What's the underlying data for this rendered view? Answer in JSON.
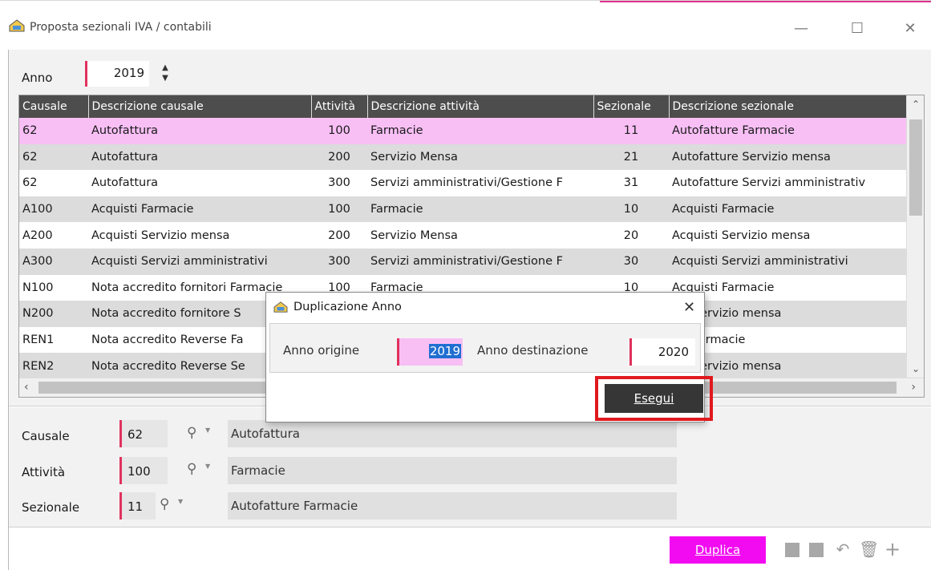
{
  "window": {
    "title": "Proposta sezionali IVA / contabili",
    "min_glyph": "—",
    "max_glyph": "☐",
    "close_glyph": "✕"
  },
  "anno": {
    "label": "Anno",
    "value": "2019"
  },
  "table": {
    "columns": [
      "Causale",
      "Descrizione causale",
      "Attività",
      "Descrizione attività",
      "Sezionale",
      "Descrizione sezionale"
    ],
    "rows": [
      [
        "62",
        "Autofattura",
        "100",
        "Farmacie",
        "11",
        "Autofatture Farmacie"
      ],
      [
        "62",
        "Autofattura",
        "200",
        "Servizio Mensa",
        "21",
        "Autofatture Servizio mensa"
      ],
      [
        "62",
        "Autofattura",
        "300",
        "Servizi amministrativi/Gestione F",
        "31",
        "Autofatture Servizi amministrativ"
      ],
      [
        "A100",
        "Acquisti Farmacie",
        "100",
        "Farmacie",
        "10",
        "Acquisti Farmacie"
      ],
      [
        "A200",
        "Acquisti Servizio mensa",
        "200",
        "Servizio Mensa",
        "20",
        "Acquisti Servizio mensa"
      ],
      [
        "A300",
        "Acquisti Servizi amministrativi",
        "300",
        "Servizi amministrativi/Gestione F",
        "30",
        "Acquisti Servizi amministrativi"
      ],
      [
        "N100",
        "Nota accredito fornitori Farmacie",
        "100",
        "Farmacie",
        "10",
        "Acquisti Farmacie"
      ],
      [
        "N200",
        "Nota accredito fornitore S",
        "",
        "",
        "",
        "isti Servizio mensa"
      ],
      [
        "REN1",
        "Nota accredito Reverse Fa",
        "",
        "",
        "",
        "isti Farmacie"
      ],
      [
        "REN2",
        "Nota accredito Reverse Se",
        "",
        "",
        "",
        "isti Servizio mensa"
      ]
    ],
    "selected_row": 0
  },
  "form": {
    "causale": {
      "label": "Causale",
      "code": "62",
      "desc": "Autofattura"
    },
    "attivita": {
      "label": "Attività",
      "code": "100",
      "desc": "Farmacie"
    },
    "sezionale": {
      "label": "Sezionale",
      "code": "11",
      "desc": "Autofatture Farmacie"
    }
  },
  "footer": {
    "duplica_label": "Duplica"
  },
  "dialog": {
    "title": "Duplicazione Anno",
    "close_glyph": "✕",
    "origin_label": "Anno origine",
    "origin_value": "2019",
    "dest_label": "Anno destinazione",
    "dest_value": "2020",
    "esegui_label": "Esegui"
  },
  "icons": {
    "search": "search-icon",
    "undo": "undo-icon",
    "trash": "trash-icon",
    "add": "plus-icon"
  },
  "colors": {
    "accent": "#f20bf0",
    "selected_row": "#f8bff5",
    "required_marker": "#e0315d",
    "header_bg": "#4d4d4d",
    "highlight_frame": "#e0191e"
  }
}
